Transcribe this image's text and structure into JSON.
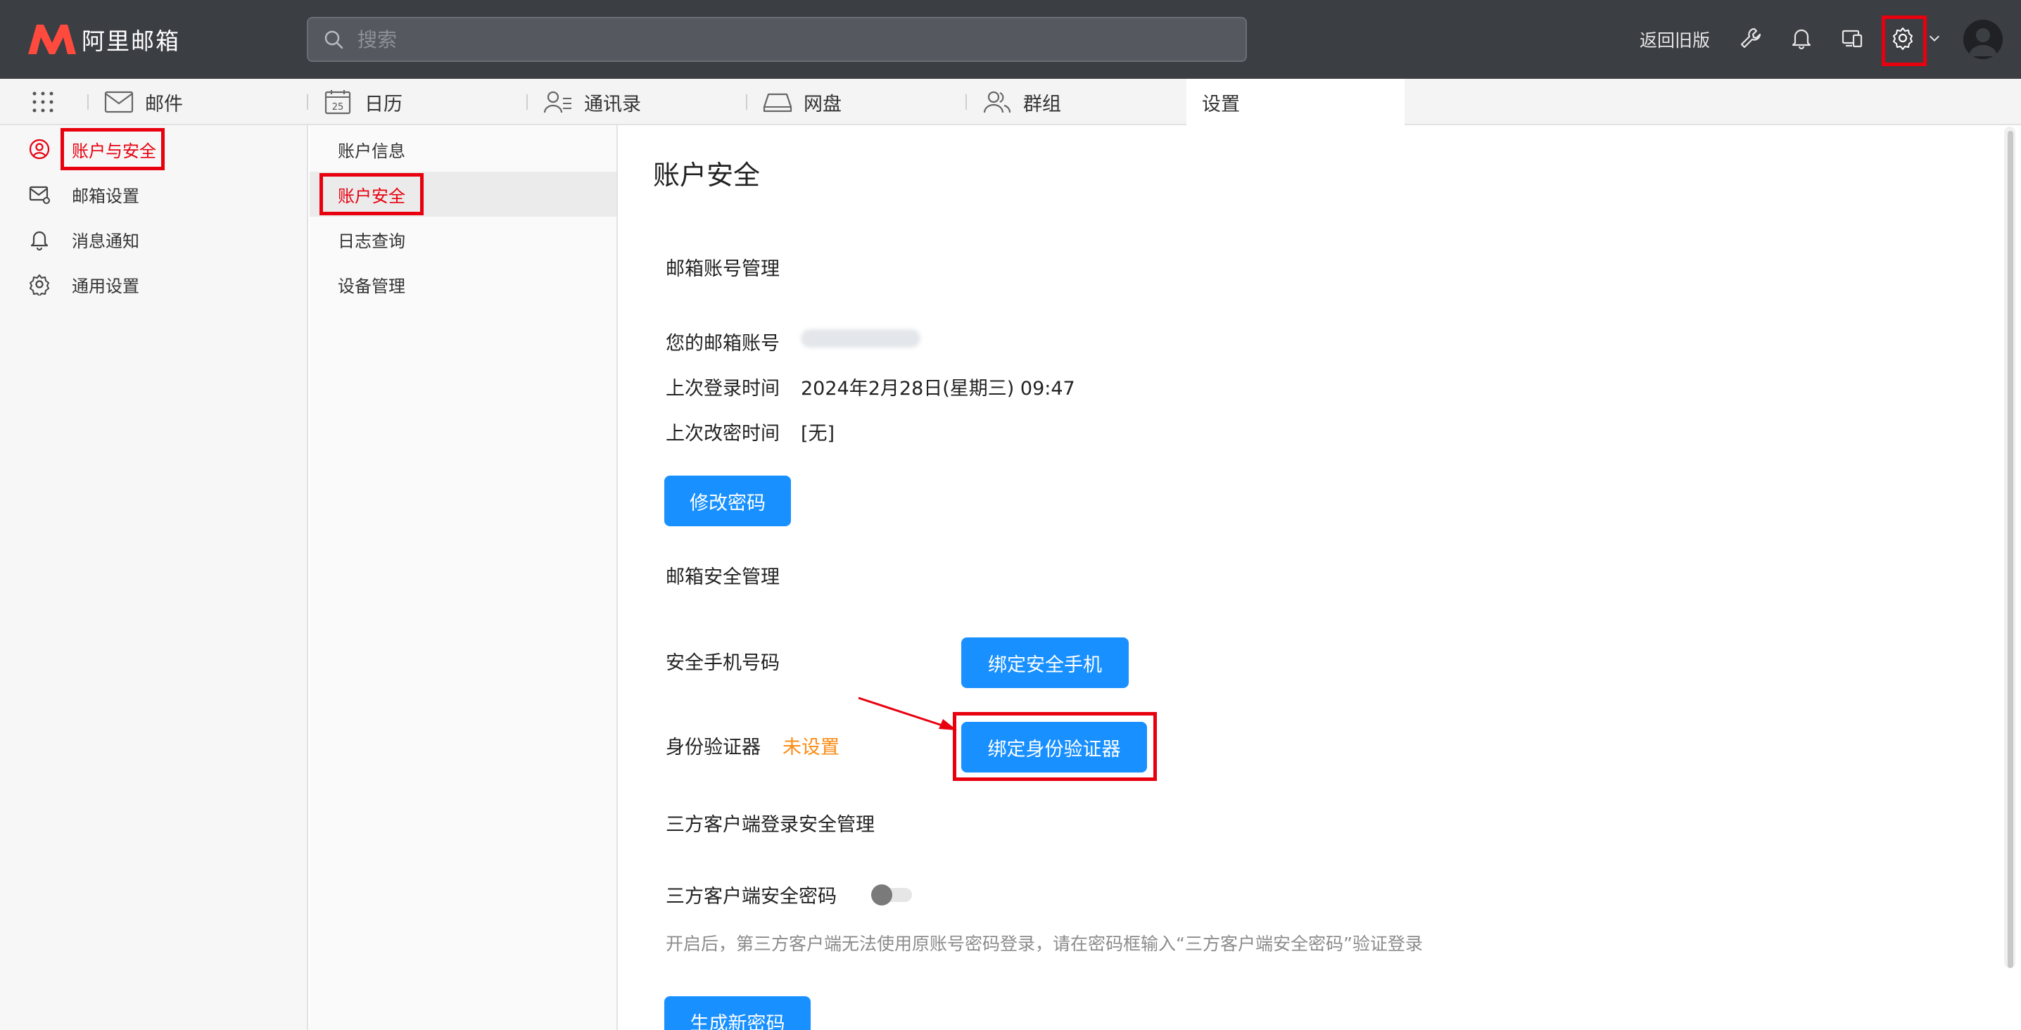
{
  "app": {
    "logo_text": "阿里邮箱",
    "search_placeholder": "搜索",
    "back_old_version": "返回旧版"
  },
  "tabs": [
    {
      "label": "邮件",
      "icon": "mail-icon"
    },
    {
      "label": "日历",
      "icon": "calendar-icon",
      "calendar_day": "25"
    },
    {
      "label": "通讯录",
      "icon": "contacts-icon"
    },
    {
      "label": "网盘",
      "icon": "drive-icon"
    },
    {
      "label": "群组",
      "icon": "group-icon"
    },
    {
      "label": "设置",
      "icon": "",
      "active": true
    }
  ],
  "sidebar": {
    "items": [
      {
        "label": "账户与安全",
        "icon": "user-icon",
        "active": true
      },
      {
        "label": "邮箱设置",
        "icon": "mail-settings-icon"
      },
      {
        "label": "消息通知",
        "icon": "bell-icon"
      },
      {
        "label": "通用设置",
        "icon": "gear-icon"
      }
    ]
  },
  "subnav": {
    "items": [
      {
        "label": "账户信息"
      },
      {
        "label": "账户安全",
        "active": true
      },
      {
        "label": "日志查询"
      },
      {
        "label": "设备管理"
      }
    ]
  },
  "main": {
    "title": "账户安全",
    "mailbox_account_section": "邮箱账号管理",
    "account_label": "您的邮箱账号",
    "last_login_label": "上次登录时间",
    "last_login_value": "2024年2月28日(星期三) 09:47",
    "last_pwd_change_label": "上次改密时间",
    "last_pwd_change_value": "[无]",
    "change_password_btn": "修改密码",
    "security_section": "邮箱安全管理",
    "phone_label": "安全手机号码",
    "bind_phone_btn": "绑定安全手机",
    "authenticator_label": "身份验证器",
    "authenticator_status": "未设置",
    "bind_authenticator_btn": "绑定身份验证器",
    "third_party_section": "三方客户端登录安全管理",
    "third_party_pwd_label": "三方客户端安全密码",
    "third_party_toggle_on": false,
    "third_party_hint": "开启后，第三方客户端无法使用原账号密码登录，请在密码框输入“三方客户端安全密码”验证登录",
    "generate_pwd_btn": "生成新密码"
  },
  "colors": {
    "topbar": "#3b3e43",
    "primary": "#1890ff",
    "highlight": "#e8000f",
    "warning": "#fa8c16"
  }
}
